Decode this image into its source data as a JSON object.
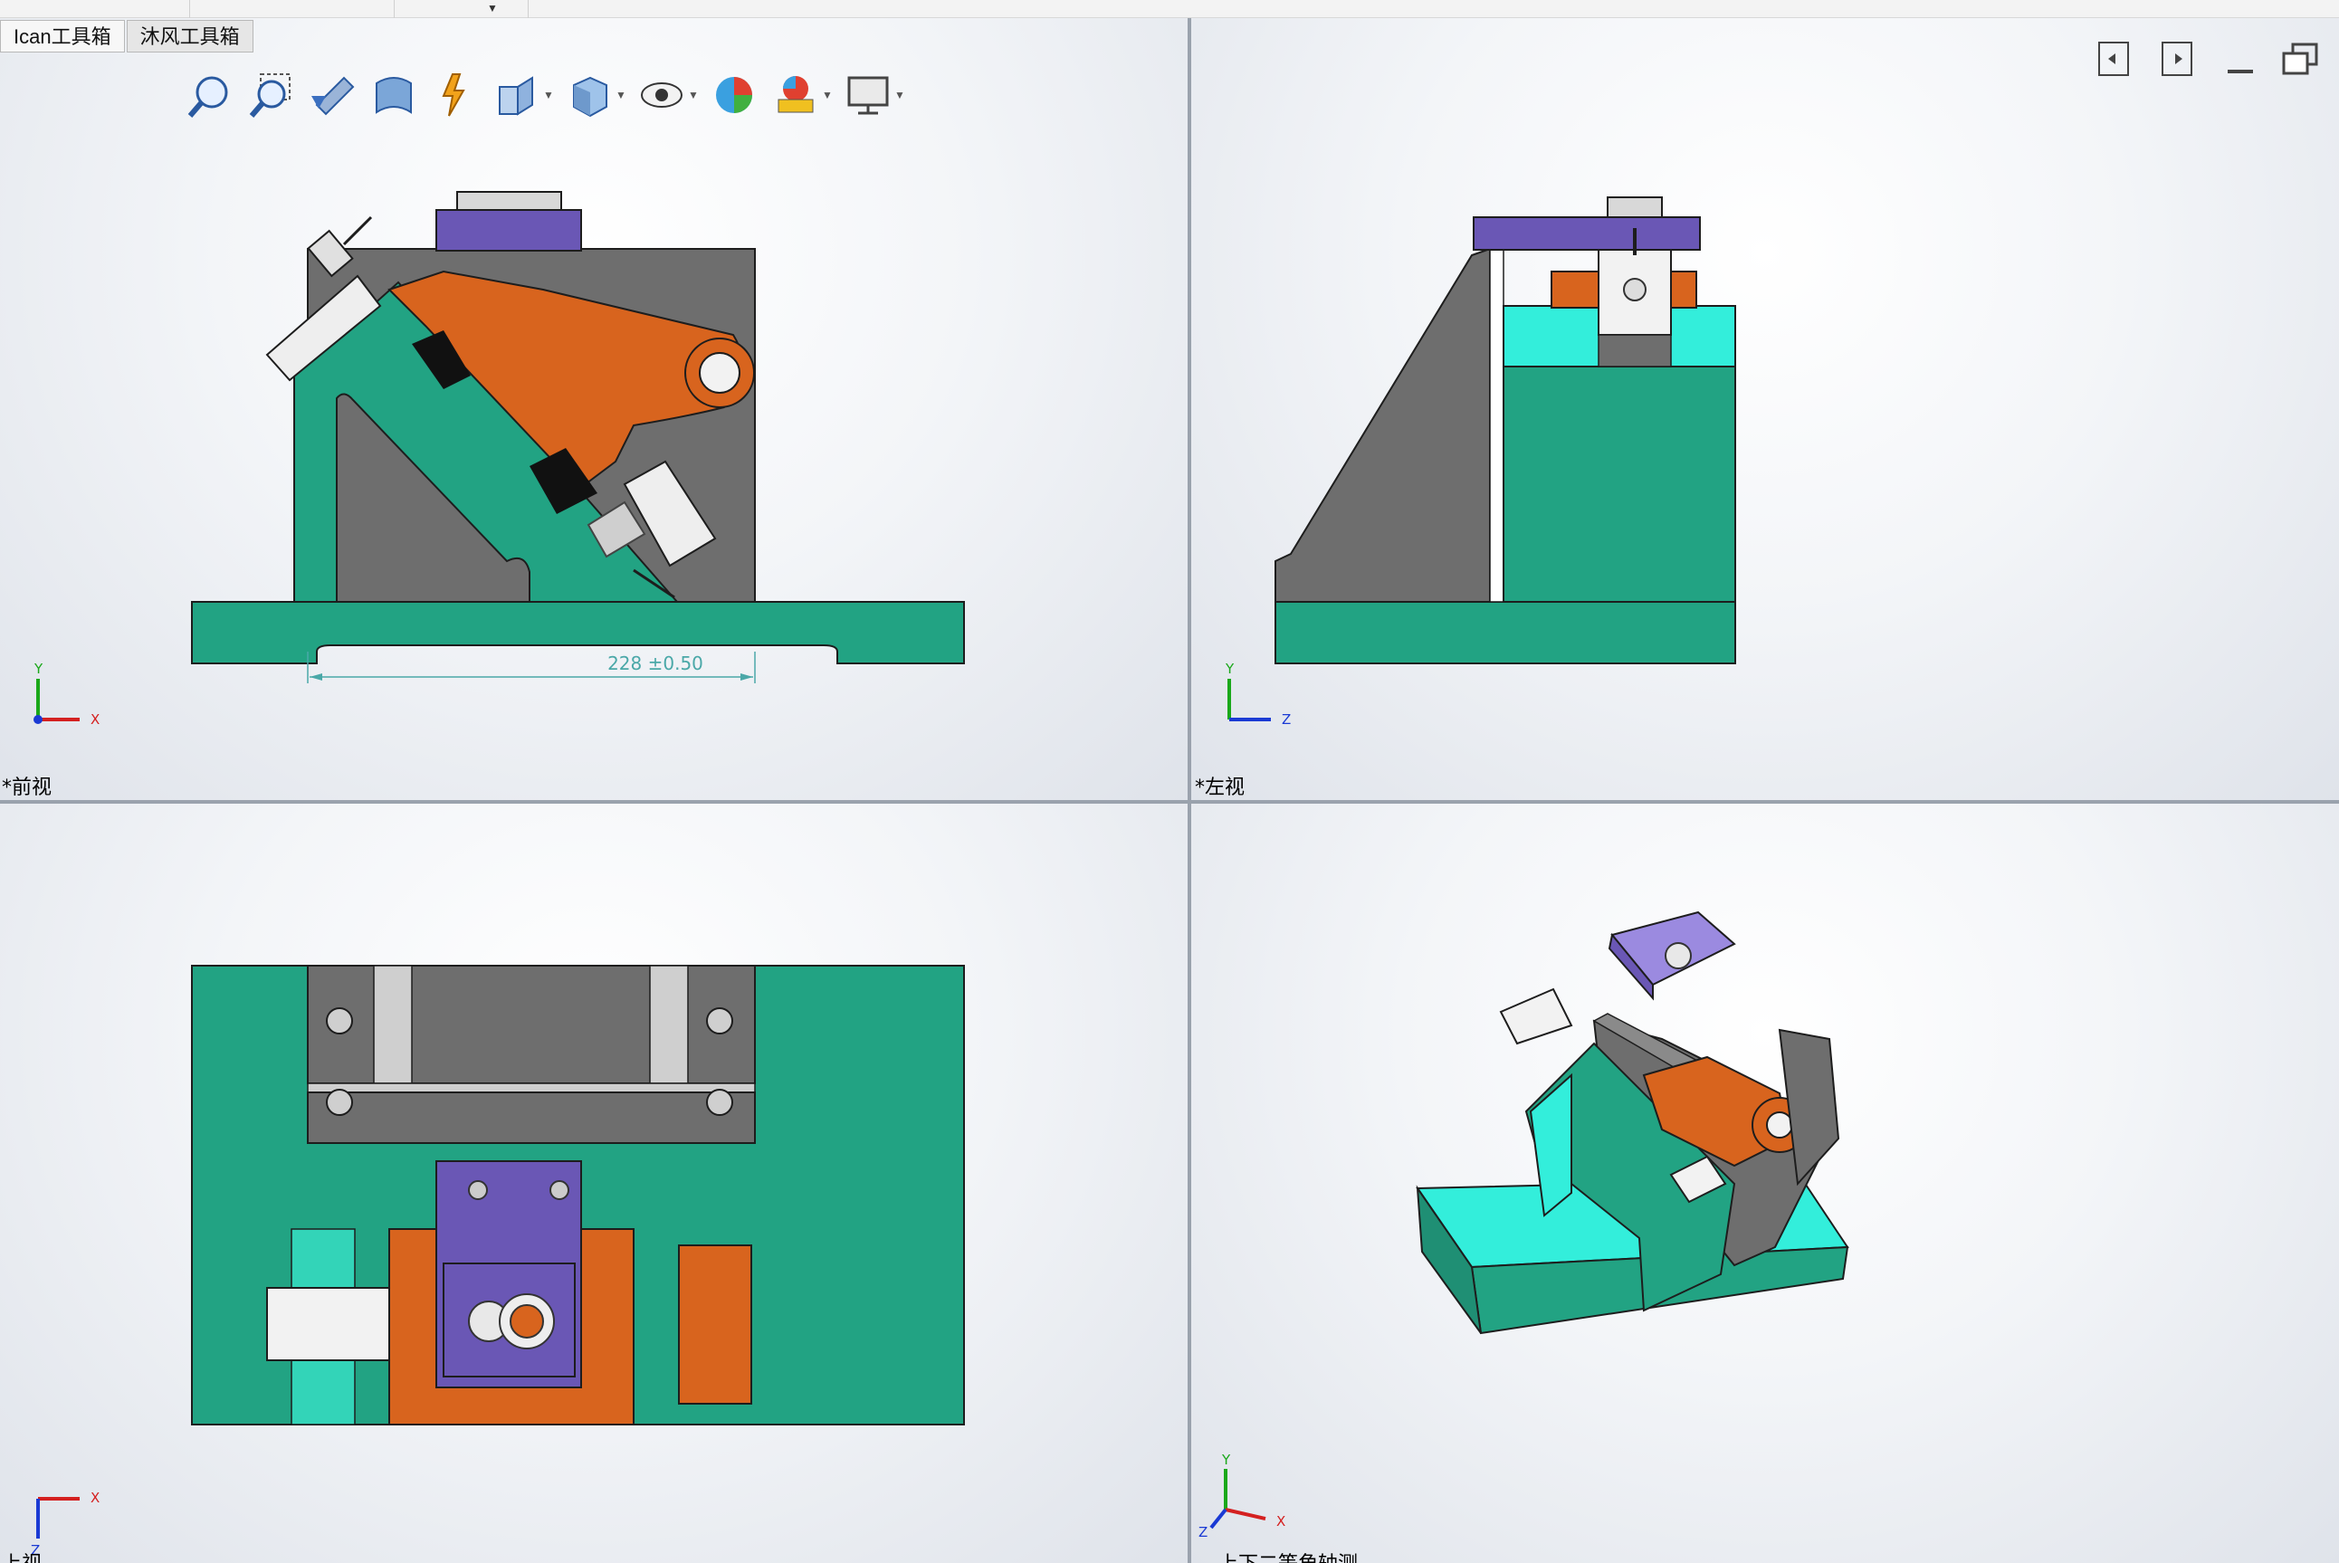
{
  "tabs": [
    {
      "label": "Ican工具箱",
      "active": true
    },
    {
      "label": "沐风工具箱",
      "active": false
    }
  ],
  "toolbar": {
    "icons": [
      "zoom-to-fit-icon",
      "zoom-to-area-icon",
      "previous-view-icon",
      "section-view-icon",
      "dynamic-annotation-icon",
      "view-orientation-icon",
      "display-style-icon",
      "hide-show-items-icon",
      "edit-appearance-icon",
      "apply-scene-icon",
      "view-settings-icon"
    ]
  },
  "views": {
    "front": {
      "label": "*前视",
      "axis_h": "X",
      "axis_v": "Y"
    },
    "left": {
      "label": "*左视",
      "axis_h": "Z",
      "axis_v": "Y"
    },
    "top": {
      "label": "上视",
      "axis_h": "X",
      "axis_v": "Z"
    },
    "iso": {
      "label": "上下二等角轴测",
      "axis_h": "X",
      "axis_v": "Y",
      "axis_d": "Z"
    }
  },
  "dimension": {
    "text": "228 ±0.50"
  },
  "colors": {
    "base_green": "#22a383",
    "cyan": "#33eedb",
    "plate_gray": "#6e6e6e",
    "orange": "#d8641e",
    "purple": "#6a57b5",
    "light_purple": "#9b8ae0"
  }
}
